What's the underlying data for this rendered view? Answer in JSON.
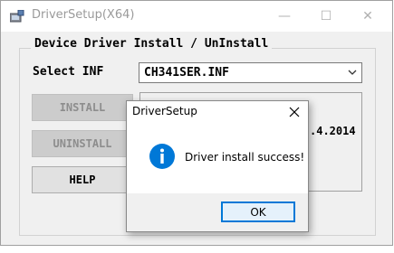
{
  "window": {
    "title": "DriverSetup(X64)",
    "controls": {
      "minimize": "—",
      "maximize": "☐",
      "close": "✕"
    }
  },
  "group": {
    "title": "Device Driver Install / UnInstall"
  },
  "select_inf": {
    "label": "Select INF",
    "value": "CH341SER.INF"
  },
  "buttons": {
    "install": "INSTALL",
    "uninstall": "UNINSTALL",
    "help": "HELP"
  },
  "info_panel": {
    "visible_text": ".4.2014"
  },
  "dialog": {
    "title": "DriverSetup",
    "message": "Driver install success!",
    "ok_label": "OK",
    "icon": "info-icon"
  },
  "colors": {
    "dialog_accent": "#0078d7",
    "disabled_button": "#cccccc",
    "window_bg": "#f0f0f0"
  }
}
